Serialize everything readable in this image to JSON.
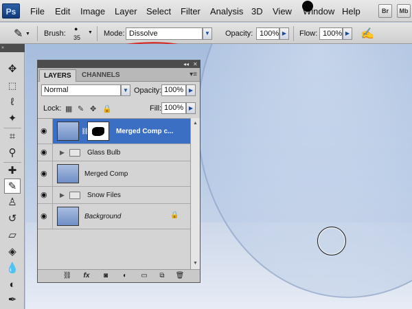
{
  "app_logo": "Ps",
  "menu": [
    "File",
    "Edit",
    "Image",
    "Layer",
    "Select",
    "Filter",
    "Analysis",
    "3D",
    "View",
    "Window",
    "Help"
  ],
  "menu_buttons": [
    "Br",
    "Mb"
  ],
  "options_bar": {
    "brush_label": "Brush:",
    "brush_size": "35",
    "mode_label": "Mode:",
    "mode_value": "Dissolve",
    "opacity_label": "Opacity:",
    "opacity_value": "100%",
    "flow_label": "Flow:",
    "flow_value": "100%"
  },
  "layers_panel": {
    "tabs": [
      "LAYERS",
      "CHANNELS"
    ],
    "blend_mode": "Normal",
    "opacity_label": "Opacity:",
    "opacity_value": "100%",
    "lock_label": "Lock:",
    "fill_label": "Fill:",
    "fill_value": "100%",
    "layers": [
      {
        "name": "Merged Comp c...",
        "type": "layer-with-mask",
        "selected": true,
        "visible": true
      },
      {
        "name": "Glass Bulb",
        "type": "group",
        "selected": false,
        "visible": true
      },
      {
        "name": "Merged Comp",
        "type": "layer",
        "selected": false,
        "visible": true
      },
      {
        "name": "Snow Files",
        "type": "group",
        "selected": false,
        "visible": true
      },
      {
        "name": "Background",
        "type": "background",
        "selected": false,
        "visible": true,
        "locked": true
      }
    ]
  },
  "colors": {
    "selection_blue": "#3a6fc4",
    "highlight_circle": "#d8201c"
  }
}
